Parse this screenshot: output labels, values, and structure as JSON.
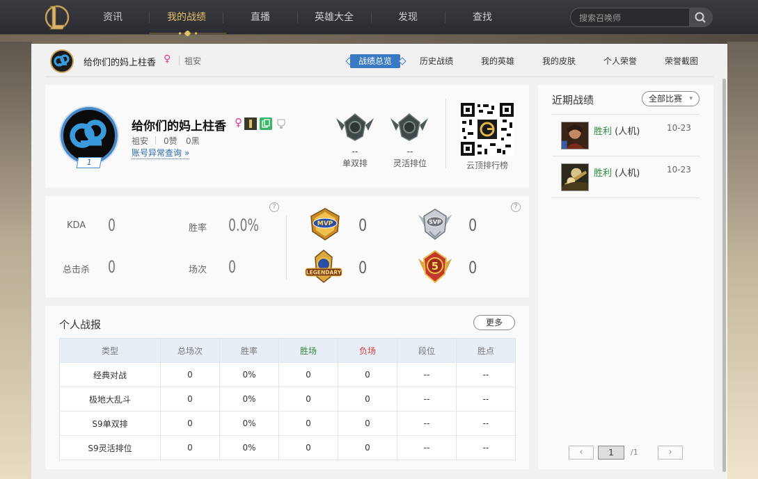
{
  "nav": {
    "items": [
      "资讯",
      "我的战绩",
      "直播",
      "英雄大全",
      "发现",
      "查找"
    ],
    "active_index": 1,
    "search_placeholder": "搜索召唤师",
    "logo_icon": "lol-logo-icon"
  },
  "subheader": {
    "name": "给你们的妈上柱香",
    "sex_icon": "♀",
    "server": "祖安",
    "tabs": [
      "战绩总览",
      "历史战绩",
      "我的英雄",
      "我的皮肤",
      "个人荣誉",
      "荣誉截图"
    ],
    "active_tab": 0
  },
  "profile": {
    "name": "给你们的妈上柱香",
    "sex_icon": "♀",
    "level": "1",
    "server": "祖安",
    "likes": "0赞",
    "blacks": "0黑",
    "account_check": "账号异常查询 »",
    "ranks": [
      {
        "value": "--",
        "label": "单双排"
      },
      {
        "value": "--",
        "label": "灵活排位"
      }
    ],
    "qr_label": "云顶排行榜"
  },
  "stats": {
    "kda_label": "KDA",
    "kda_value": "0",
    "winrate_label": "胜率",
    "winrate_value": "0.0%",
    "kills_label": "总击杀",
    "kills_value": "0",
    "games_label": "场次",
    "games_value": "0",
    "help_icon": "?",
    "badges": [
      {
        "name": "MVP",
        "value": "0"
      },
      {
        "name": "SVP",
        "value": "0"
      },
      {
        "name": "LEGENDARY",
        "value": "0"
      },
      {
        "name": "5",
        "value": "0"
      }
    ]
  },
  "report": {
    "title": "个人战报",
    "more_label": "更多",
    "headers": [
      "类型",
      "总场次",
      "胜率",
      "胜场",
      "负场",
      "段位",
      "胜点"
    ],
    "rows": [
      [
        "经典对战",
        "0",
        "0%",
        "0",
        "0",
        "--",
        "--"
      ],
      [
        "极地大乱斗",
        "0",
        "0%",
        "0",
        "0",
        "--",
        "--"
      ],
      [
        "S9单双排",
        "0",
        "0%",
        "0",
        "0",
        "--",
        "--"
      ],
      [
        "S9灵活排位",
        "0",
        "0%",
        "0",
        "0",
        "--",
        "--"
      ]
    ]
  },
  "recent": {
    "title": "近期战绩",
    "filter_label": "全部比赛",
    "items": [
      {
        "result": "胜利",
        "mode": "(人机)",
        "date": "10-23"
      },
      {
        "result": "胜利",
        "mode": "(人机)",
        "date": "10-23"
      }
    ],
    "pagination": {
      "current": "1",
      "total": "/1",
      "prev": "‹",
      "next": "›"
    }
  },
  "colors": {
    "accent": "#3a7ac4",
    "win": "#2e8a3c",
    "lose": "#d13b3b",
    "nav_active": "#e4c06a"
  }
}
